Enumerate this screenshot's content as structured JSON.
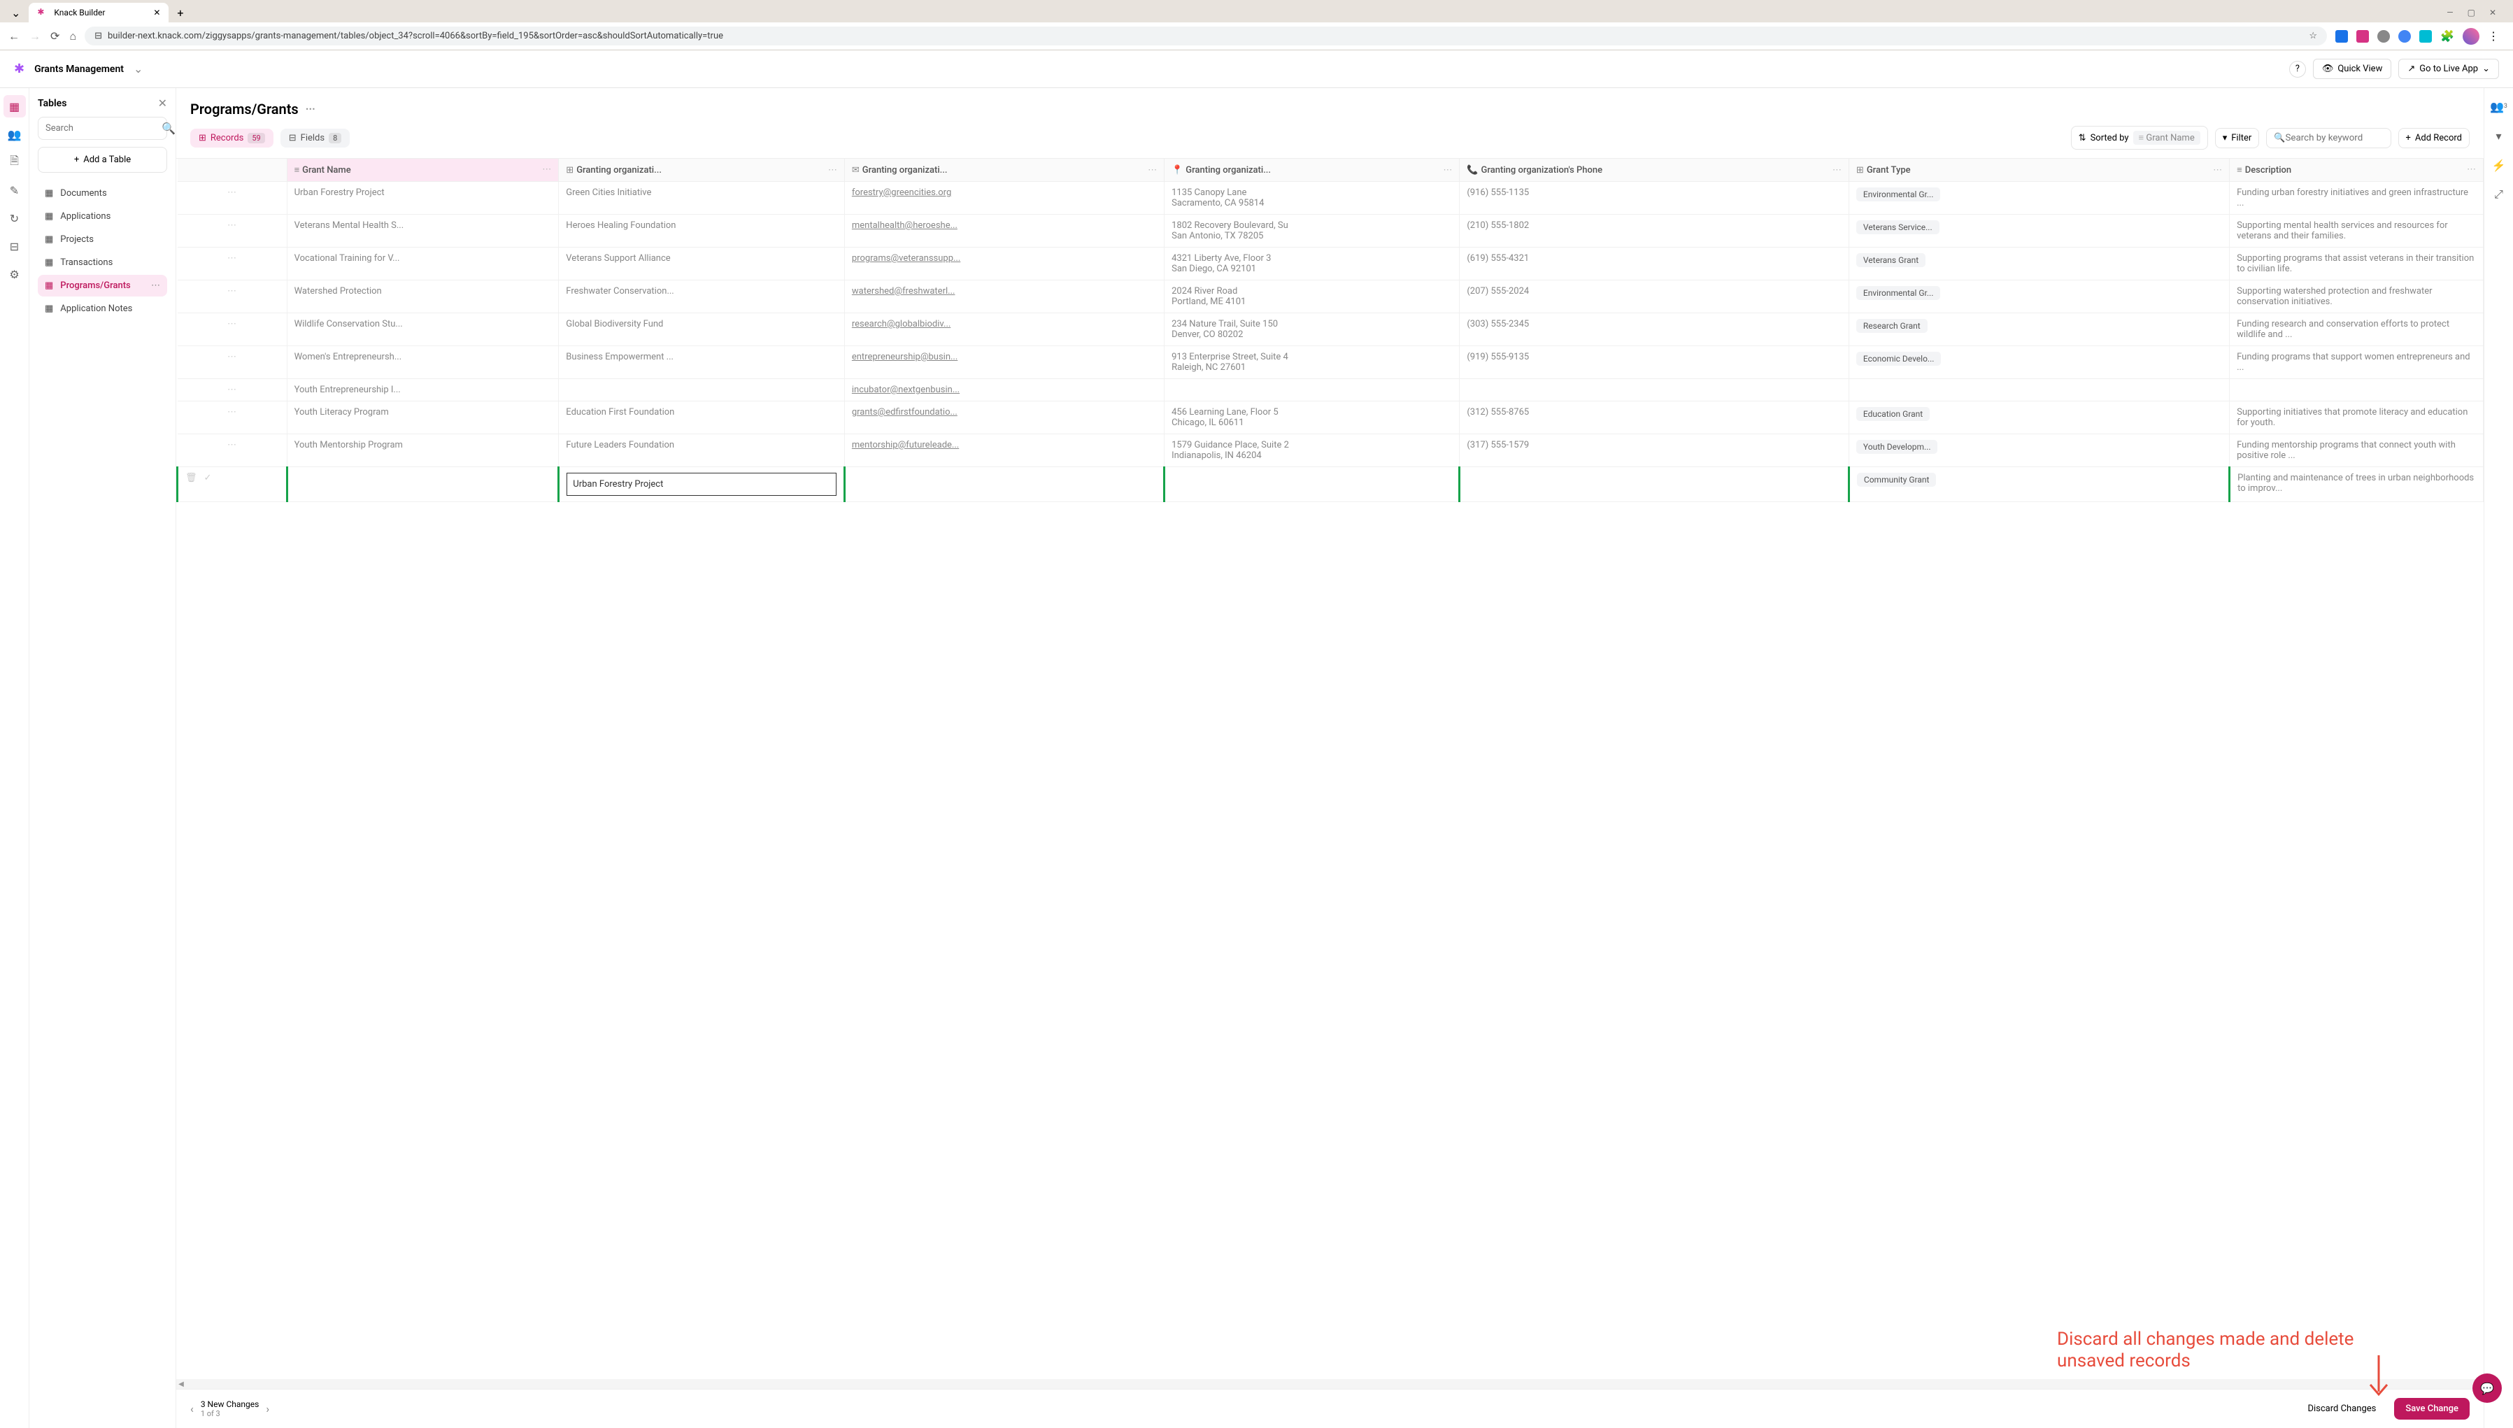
{
  "browser": {
    "tab_title": "Knack Builder",
    "url": "builder-next.knack.com/ziggysapps/grants-management/tables/object_34?scroll=4066&sortBy=field_195&sortOrder=asc&shouldSortAutomatically=true"
  },
  "header": {
    "app_name": "Grants Management",
    "quick_view": "Quick View",
    "go_live": "Go to Live App"
  },
  "sidebar": {
    "title": "Tables",
    "search_placeholder": "Search",
    "add_table": "Add a Table",
    "items": [
      {
        "label": "Documents",
        "active": false
      },
      {
        "label": "Applications",
        "active": false
      },
      {
        "label": "Projects",
        "active": false
      },
      {
        "label": "Transactions",
        "active": false
      },
      {
        "label": "Programs/Grants",
        "active": true
      },
      {
        "label": "Application Notes",
        "active": false
      }
    ]
  },
  "page": {
    "title": "Programs/Grants",
    "records_label": "Records",
    "records_count": "59",
    "fields_label": "Fields",
    "fields_count": "8",
    "sorted_by": "Sorted by",
    "sort_field": "Grant Name",
    "filter": "Filter",
    "search_placeholder": "Search by keyword",
    "add_record": "Add Record"
  },
  "columns": [
    {
      "icon": "≡",
      "label": "Grant Name"
    },
    {
      "icon": "⊞",
      "label": "Granting organizati..."
    },
    {
      "icon": "✉",
      "label": "Granting organizati..."
    },
    {
      "icon": "📍",
      "label": "Granting organizati..."
    },
    {
      "icon": "📞",
      "label": "Granting organization's Phone"
    },
    {
      "icon": "⊞",
      "label": "Grant Type"
    },
    {
      "icon": "≡",
      "label": "Description"
    }
  ],
  "rows": [
    {
      "name": "Urban Forestry Project",
      "org": "Green Cities Initiative",
      "email": "forestry@greencities.org",
      "addr1": "1135 Canopy Lane",
      "addr2": "Sacramento, CA 95814",
      "phone": "(916) 555-1135",
      "type": "Environmental Gr...",
      "desc": "Funding urban forestry initiatives and green infrastructure ..."
    },
    {
      "name": "Veterans Mental Health S...",
      "org": "Heroes Healing Foundation",
      "email": "mentalhealth@heroeshe...",
      "addr1": "1802 Recovery Boulevard, Su",
      "addr2": "San Antonio, TX 78205",
      "phone": "(210) 555-1802",
      "type": "Veterans Service...",
      "desc": "Supporting mental health services and resources for veterans and their families."
    },
    {
      "name": "Vocational Training for V...",
      "org": "Veterans Support Alliance",
      "email": "programs@veteranssupp...",
      "addr1": "4321 Liberty Ave, Floor 3",
      "addr2": "San Diego, CA 92101",
      "phone": "(619) 555-4321",
      "type": "Veterans Grant",
      "desc": "Supporting programs that assist veterans in their transition to civilian life."
    },
    {
      "name": "Watershed Protection",
      "org": "Freshwater Conservation...",
      "email": "watershed@freshwaterl...",
      "addr1": "2024 River Road",
      "addr2": "Portland, ME 4101",
      "phone": "(207) 555-2024",
      "type": "Environmental Gr...",
      "desc": "Supporting watershed protection and freshwater conservation initiatives."
    },
    {
      "name": "Wildlife Conservation Stu...",
      "org": "Global Biodiversity Fund",
      "email": "research@globalbiodiv...",
      "addr1": "234 Nature Trail, Suite 150",
      "addr2": "Denver, CO 80202",
      "phone": "(303) 555-2345",
      "type": "Research Grant",
      "desc": "Funding research and conservation efforts to protect wildlife and ..."
    },
    {
      "name": "Women's Entrepreneursh...",
      "org": "Business Empowerment ...",
      "email": "entrepreneurship@busin...",
      "addr1": "913 Enterprise Street, Suite 4",
      "addr2": "Raleigh, NC 27601",
      "phone": "(919) 555-9135",
      "type": "Economic Develo...",
      "desc": "Funding programs that support women entrepreneurs and ..."
    },
    {
      "name": "Youth Entrepreneurship I...",
      "org": "",
      "email": "incubator@nextgenbusin...",
      "addr1": "",
      "addr2": "",
      "phone": "",
      "type": "",
      "desc": ""
    },
    {
      "name": "Youth Literacy Program",
      "org": "Education First Foundation",
      "email": "grants@edfirstfoundatio...",
      "addr1": "456 Learning Lane, Floor 5",
      "addr2": "Chicago, IL 60611",
      "phone": "(312) 555-8765",
      "type": "Education Grant",
      "desc": "Supporting initiatives that promote literacy and education for youth."
    },
    {
      "name": "Youth Mentorship Program",
      "org": "Future Leaders Foundation",
      "email": "mentorship@futureleade...",
      "addr1": "1579 Guidance Place, Suite 2",
      "addr2": "Indianapolis, IN 46204",
      "phone": "(317) 555-1579",
      "type": "Youth Developm...",
      "desc": "Funding mentorship programs that connect youth with positive role ..."
    }
  ],
  "new_row": {
    "name": "Urban Forestry Project",
    "type": "Community Grant",
    "desc": "Planting and maintenance of trees in urban neighborhoods to improv..."
  },
  "footer": {
    "changes": "3 New Changes",
    "page_of": "1 of 3",
    "discard": "Discard Changes",
    "save": "Save Change"
  },
  "annotation": {
    "text": "Discard all changes made and delete unsaved records"
  }
}
